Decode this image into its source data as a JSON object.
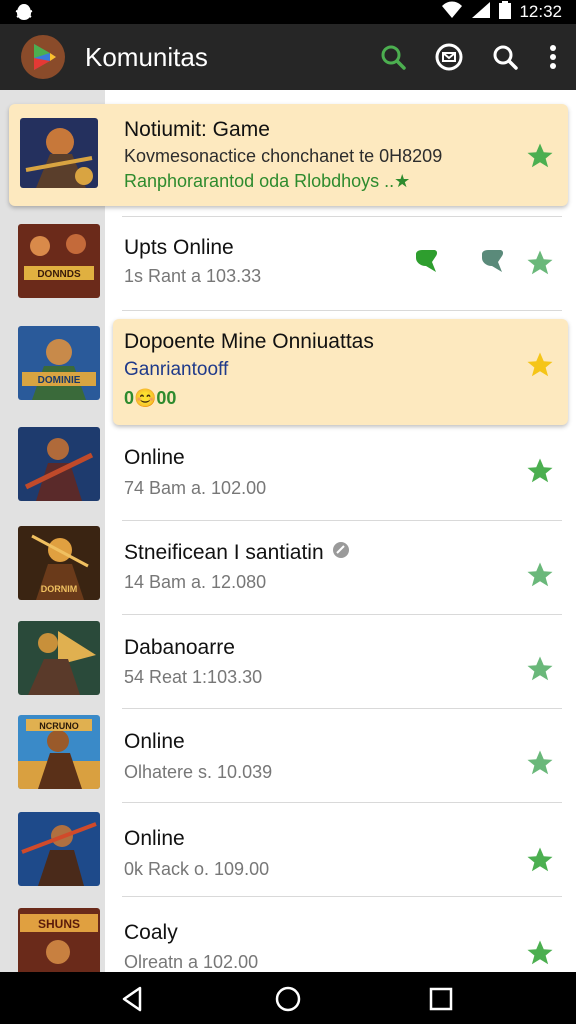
{
  "status_bar": {
    "time": "12:32",
    "icons": [
      "bug-icon",
      "wifi-icon",
      "signal-icon",
      "battery-icon"
    ]
  },
  "app_bar": {
    "title": "Komunitas",
    "actions": [
      "search-green-icon",
      "message-icon",
      "search-icon",
      "overflow-menu-icon"
    ],
    "accent": "#4caf50"
  },
  "colors": {
    "card_highlight": "#fde9bf",
    "star_green": "#4caf50",
    "star_yellow": "#f5c518",
    "side_strip": "#e1e1e1"
  },
  "items": [
    {
      "title": "Notiumit: Game",
      "line1": "Kovmesonactice chonchanet te 0H8209",
      "line2": "Ranphorarantod oda Rlobdhoys  ..★",
      "star": "green",
      "highlighted": true
    },
    {
      "title": "Upts Online",
      "subtitle": "1s Rant a 103.33",
      "star": "green",
      "extra_icons": [
        "chat-bubble-icon",
        "chat-bubble-icon"
      ]
    },
    {
      "title": "Dopoente Mine Onniuattas",
      "line1": "Ganriantooff",
      "line2": "0😊00",
      "star": "yellow",
      "highlighted": true
    },
    {
      "title": "Online",
      "subtitle": "74 Bam a. 102.00",
      "star": "green"
    },
    {
      "title": "Stneificean I santiatin",
      "subtitle": "14 Bam a. 12.080",
      "star": "green",
      "title_icon": "verified-icon"
    },
    {
      "title": "Dabanoarre",
      "subtitle": "54 Reat 1:103.30",
      "star": "green"
    },
    {
      "title": "Online",
      "subtitle": "Olhatere s. 10.039",
      "star": "green"
    },
    {
      "title": "Online",
      "subtitle": "0k Rack o. 109.00",
      "star": "green"
    },
    {
      "title": "Coaly",
      "subtitle": "Olreatn a 102.00",
      "star": "green"
    }
  ],
  "nav_bar": {
    "buttons": [
      "back-icon",
      "home-icon",
      "recents-icon"
    ]
  }
}
